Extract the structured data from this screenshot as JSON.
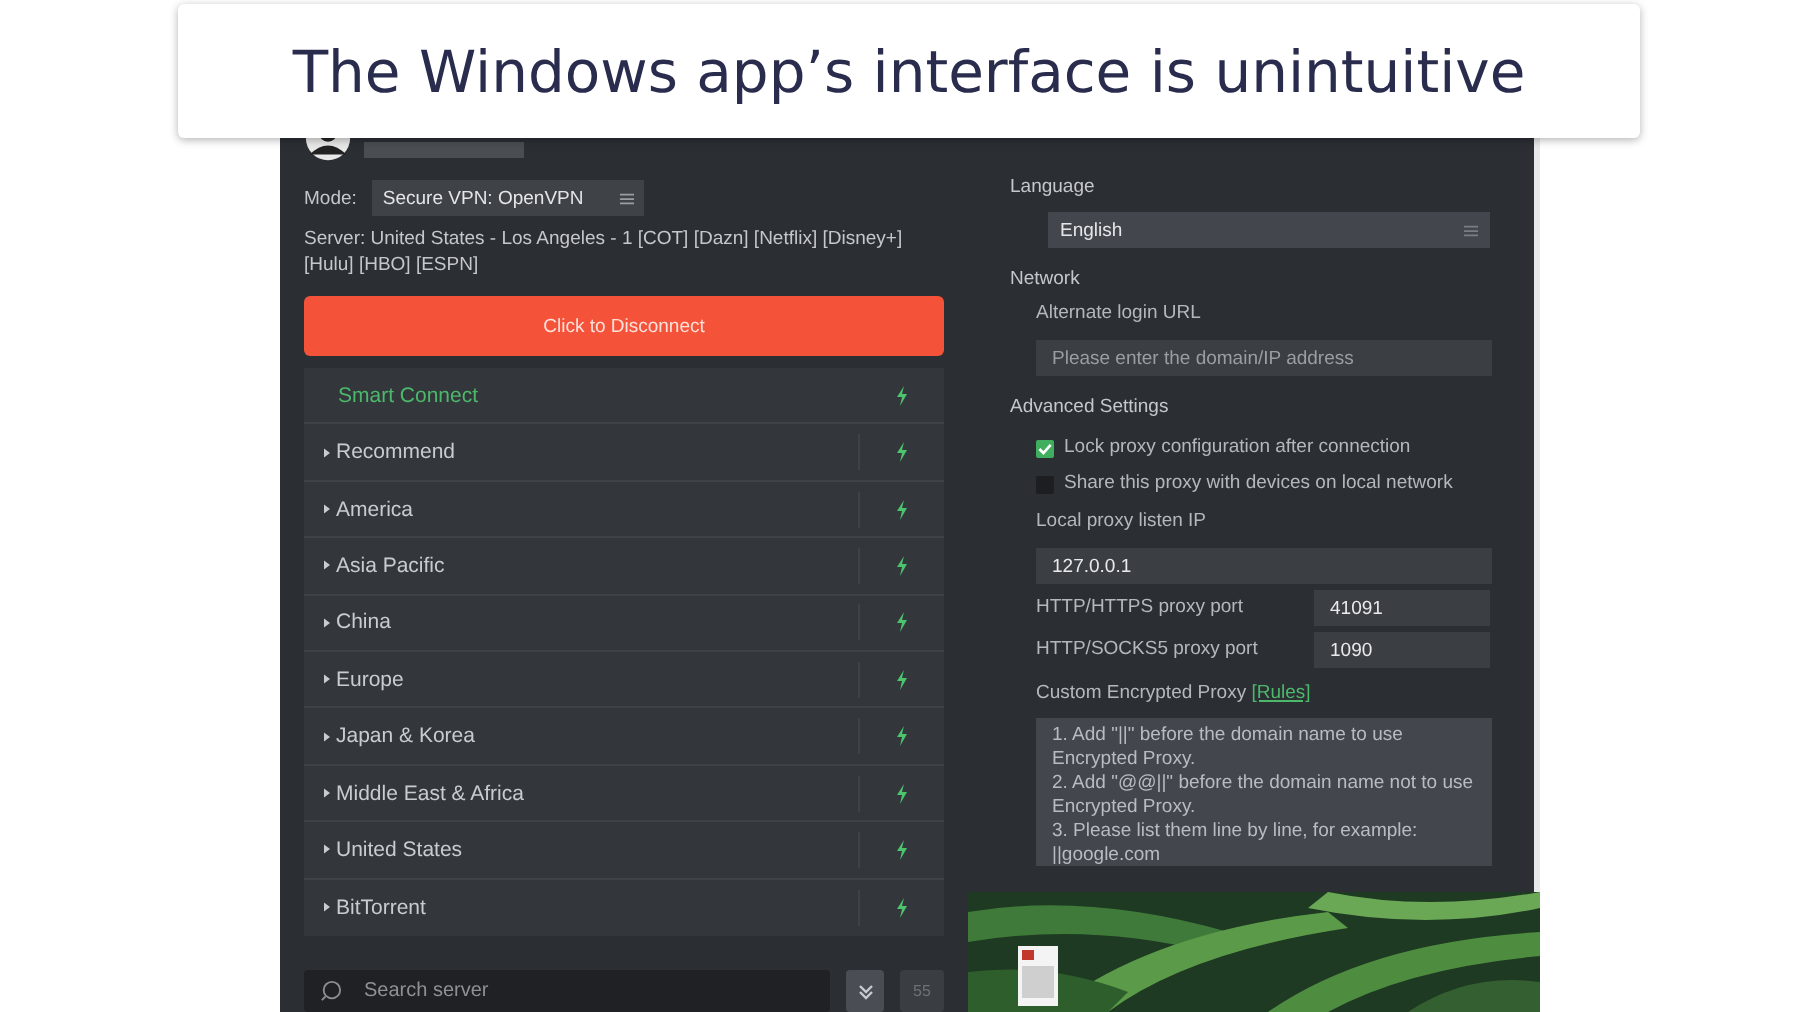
{
  "heading": "The Windows app’s interface is unintuitive",
  "mode": {
    "label": "Mode:",
    "value": "Secure VPN: OpenVPN"
  },
  "server": "Server: United States - Los Angeles - 1 [COT] [Dazn] [Netflix] [Disney+] [Hulu] [HBO] [ESPN]",
  "disconnect_button": "Click to Disconnect",
  "servers": [
    {
      "kind": "smart",
      "label": "Smart Connect"
    },
    {
      "kind": "group",
      "label": "Recommend"
    },
    {
      "kind": "group",
      "label": "America"
    },
    {
      "kind": "group",
      "label": "Asia Pacific"
    },
    {
      "kind": "group",
      "label": "China"
    },
    {
      "kind": "group",
      "label": "Europe"
    },
    {
      "kind": "group",
      "label": "Japan & Korea"
    },
    {
      "kind": "group",
      "label": "Middle East & Africa"
    },
    {
      "kind": "group",
      "label": "United States"
    },
    {
      "kind": "group",
      "label": "BitTorrent"
    }
  ],
  "search": {
    "placeholder": "Search server"
  },
  "count": "55",
  "settings": {
    "language": {
      "label": "Language",
      "value": "English"
    },
    "network": {
      "heading": "Network",
      "url_label": "Alternate login URL",
      "placeholder": "Please enter the domain/IP address"
    },
    "advanced": {
      "heading": "Advanced Settings",
      "options": [
        {
          "label": "Lock proxy configuration after connection",
          "checked": true
        },
        {
          "label": "Share this proxy with devices on local network",
          "checked": false
        }
      ],
      "listen_ip": {
        "label": "Local proxy listen IP",
        "value": "127.0.0.1"
      },
      "ports": [
        {
          "label": "HTTP/HTTPS proxy port",
          "value": "41091"
        },
        {
          "label": "HTTP/SOCKS5 proxy port",
          "value": "1090"
        }
      ],
      "custom": {
        "label": "Custom Encrypted Proxy",
        "link": "[Rules]",
        "text": "1. Add \"||\" before the domain name to use Encrypted Proxy.\n2. Add \"@@||\" before the domain name not to use Encrypted Proxy.\n3. Please list them line by line, for example:\n||google.com"
      }
    }
  }
}
